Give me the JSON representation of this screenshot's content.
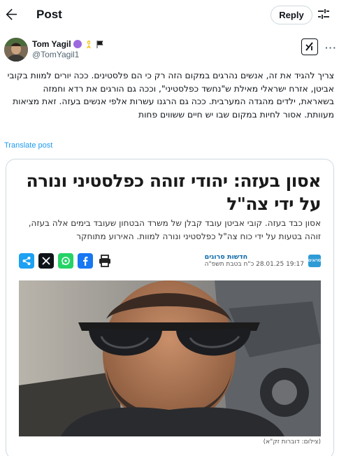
{
  "header": {
    "back_icon": "arrow-left-icon",
    "title": "Post",
    "reply_label": "Reply",
    "settings_icon": "sliders-icon"
  },
  "author": {
    "name": "Tom Yagil",
    "handle": "@TomYagil1",
    "badges": [
      "purple-circle-emoji",
      "yellow-ribbon-emoji",
      "black-flag-emoji"
    ],
    "grok_icon": "grok-icon",
    "more_icon": "more-icon"
  },
  "post": {
    "text": "צריך להגיד את זה, אנשים נהרגים במקום הזה רק כי הם פלסטינים. ככה יורים למוות בקובי אביטן, אזרח ישראלי מאילת ש\"נחשד כפלסטיני\", וככה גם הורגים את רדא וחמזה בשאראת, ילדים מהגדה המערבית. ככה גם הרגנו עשרות אלפי אנשים בעזה. זאת מציאות מעוותת. אסור לחיות במקום שבו יש חיים ששווים פחות",
    "translate_label": "Translate post"
  },
  "article": {
    "title": "אסון בעזה: יהודי זוהה כפלסטיני ונורה על ידי צה\"ל",
    "subtitle": "אסון כבד בעזה. קובי אביטן עובד קבלן של משרד הבטחון שעובד בימים אלה בעזה, זוהה בטעות על ידי כוח צה\"ל כפלסטיני ונורה למוות. האירוע מתוחקר",
    "byline_author": "חדשות סרוגים",
    "date": "19:17 28.01.25",
    "hebrew_date": "כ\"ח בטבת תשפ\"ה",
    "brand_text": "סרוגים",
    "caption": "(צילום: דוברות זק\"א)",
    "share_icons": [
      "share-icon",
      "x-icon",
      "whatsapp-icon",
      "facebook-icon",
      "print-icon"
    ]
  },
  "colors": {
    "link": "#1d9bf0",
    "text": "#0f1419",
    "muted": "#536471",
    "border": "#cfd9de",
    "share": "#1da1f2",
    "whatsapp": "#25d366",
    "facebook": "#1877f2"
  }
}
